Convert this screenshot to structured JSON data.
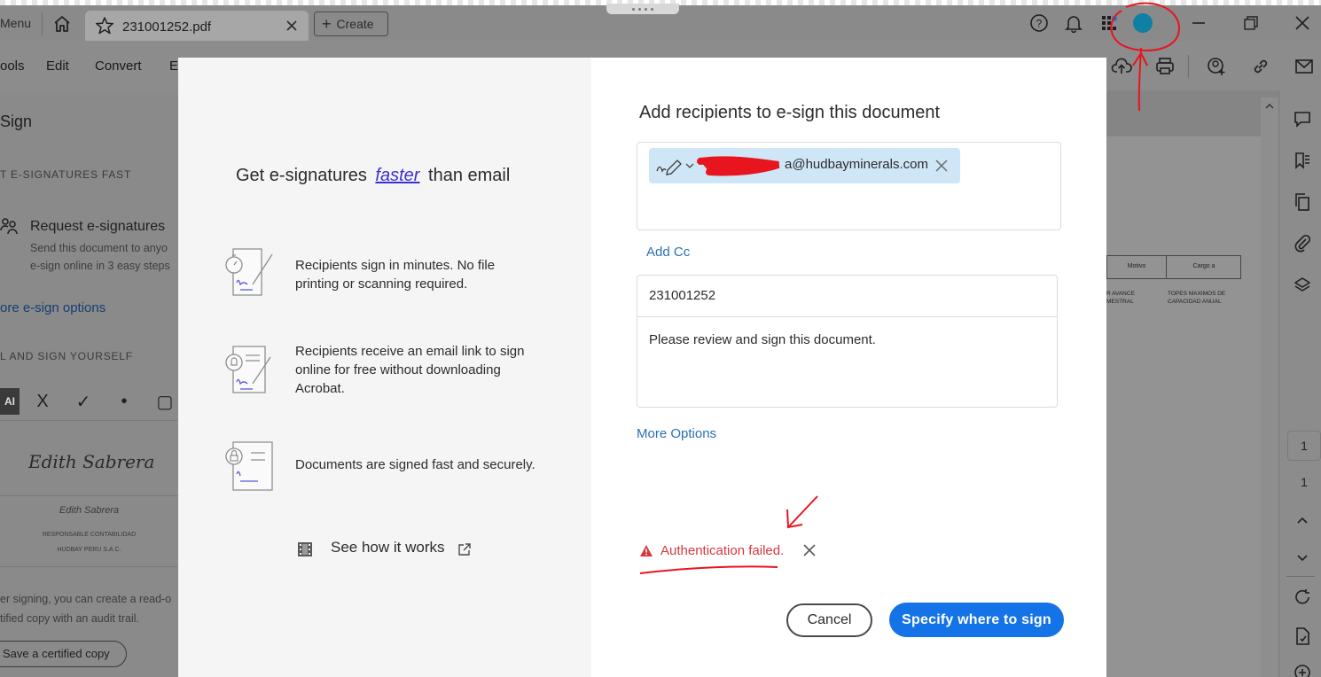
{
  "titlebar": {
    "menu_label": "Menu",
    "tab_title": "231001252.pdf",
    "create_label": "Create"
  },
  "menubar": {
    "items": [
      "ools",
      "Edit",
      "Convert",
      "E"
    ]
  },
  "left_panel": {
    "title": "Sign",
    "section1_heading": "T E-SIGNATURES FAST",
    "request_title": "Request e-signatures",
    "request_desc_1": "Send this document to anyo",
    "request_desc_2": "e-sign online in 3 easy steps",
    "more_options_link": "ore e-sign options",
    "section2_heading": "L AND SIGN YOURSELF",
    "tools": [
      "AI",
      "X",
      "✓",
      "•",
      "▢"
    ],
    "signature_script": "Edith Sabrera",
    "signature_name": "Edith Sabrera",
    "signature_role": "RESPONSABLE CONTABILIDAD",
    "signature_company": "HUDBAY PERU S.A.C.",
    "footer_line1": "er signing, you can create a read-o",
    "footer_line2": "tified copy with an audit trail.",
    "save_copy_button": "Save a certified copy"
  },
  "doc_preview": {
    "col1_header": "Motivo",
    "col2_header": "Cargo a",
    "cell1_line1": "R AVANCE",
    "cell1_line2": "MESTRAL",
    "cell2_line1": "TOPES MAXIMOS DE",
    "cell2_line2": "CAPACIDAD ANUAL"
  },
  "page_nav": {
    "current_page": "1",
    "total_pages": "1"
  },
  "dialog": {
    "headline_before": "Get e-signatures",
    "headline_emphasis": "faster",
    "headline_after": "than email",
    "features": [
      {
        "icon": "stopwatch-pen-icon",
        "text": "Recipients sign in minutes. No file printing or scanning required."
      },
      {
        "icon": "bell-document-icon",
        "text": "Recipients receive an email link to sign online for free without downloading Acrobat."
      },
      {
        "icon": "lock-document-icon",
        "text": "Documents are signed fast and securely."
      }
    ],
    "see_how_label": "See how it works",
    "right_title": "Add recipients to e-sign this document",
    "recipient_email": "a@hudbayminerals.com",
    "add_cc_label": "Add Cc",
    "document_name": "231001252",
    "message": "Please review and sign this document.",
    "more_options_label": "More Options",
    "error_message": "Authentication failed.",
    "cancel_label": "Cancel",
    "primary_label": "Specify where to sign"
  },
  "colors": {
    "primary_blue": "#1473e6",
    "link_blue": "#2a6fb8",
    "error_red": "#d7373f",
    "chip_blue": "#cfe6f7",
    "annotation_red": "#e8141e",
    "avatar_teal": "#0f7fa3"
  }
}
